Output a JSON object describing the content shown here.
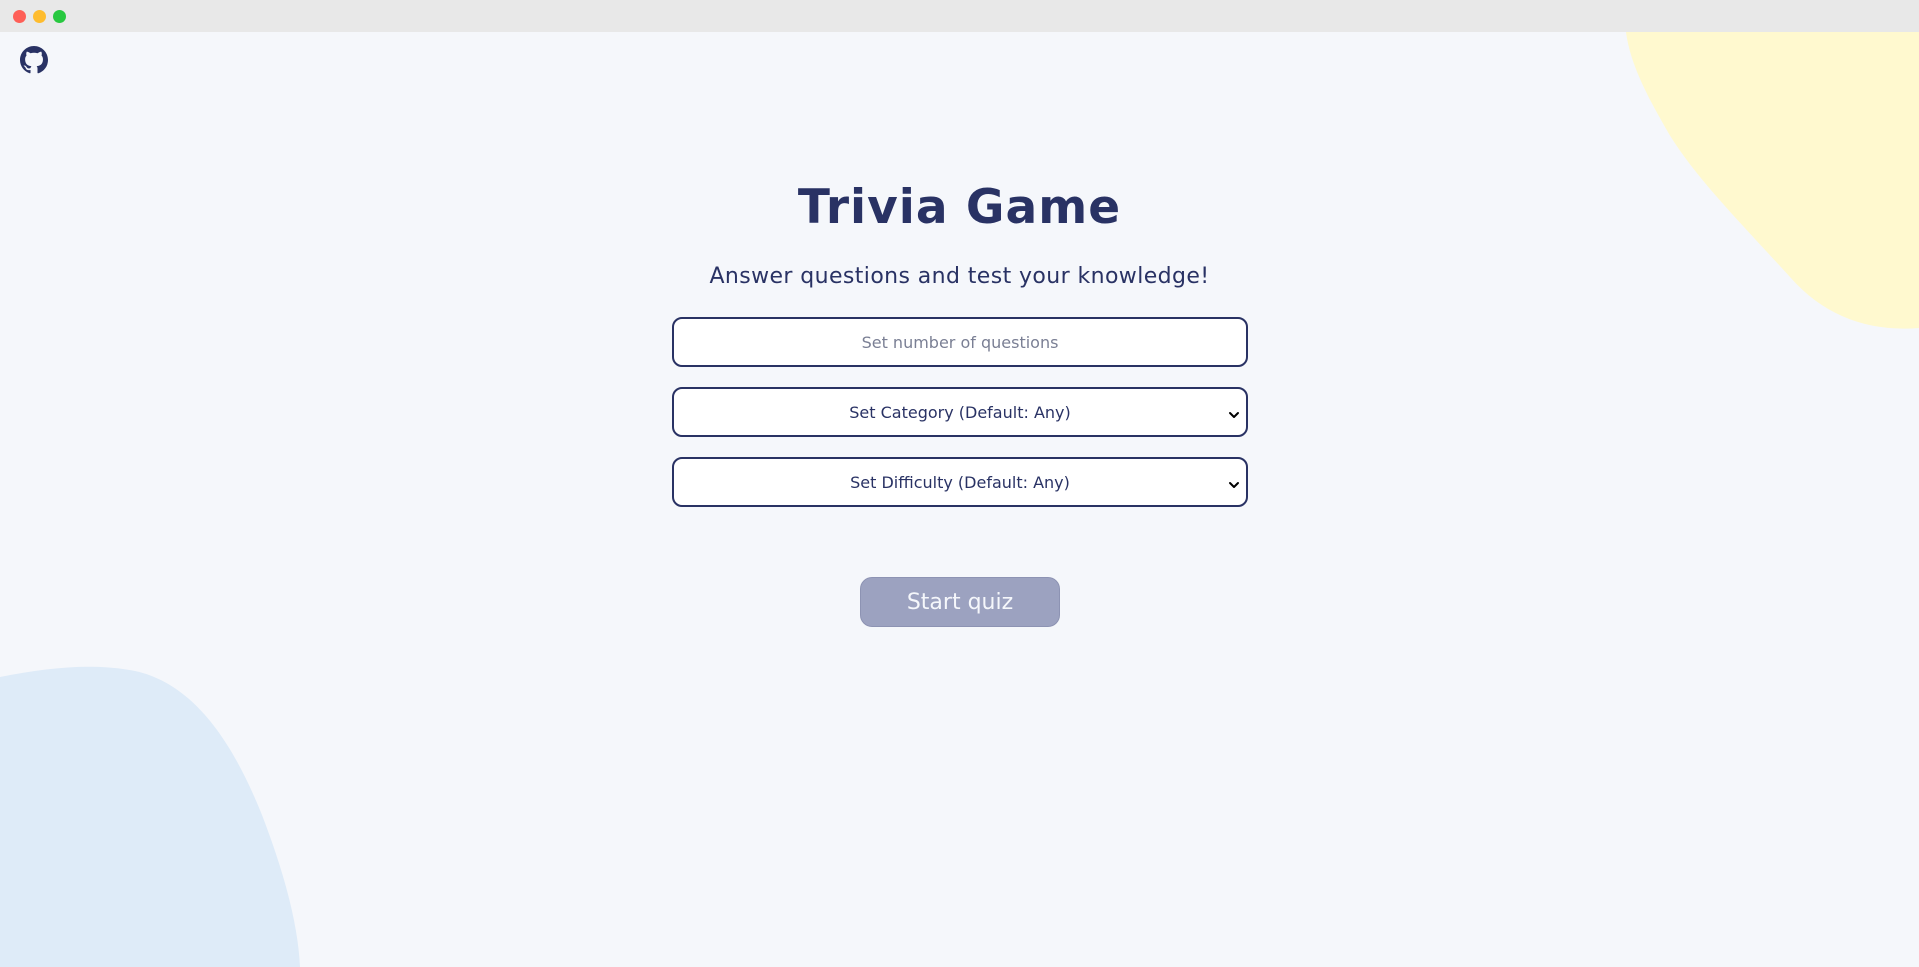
{
  "header": {
    "github_icon": "github-icon"
  },
  "main": {
    "title": "Trivia Game",
    "subtitle": "Answer questions and test your knowledge!",
    "questions_input": {
      "placeholder": "Set number of questions",
      "value": ""
    },
    "category_select": {
      "selected": "Set Category (Default: Any)"
    },
    "difficulty_select": {
      "selected": "Set Difficulty (Default: Any)"
    },
    "start_button_label": "Start quiz"
  },
  "colors": {
    "text": "#293264",
    "background": "#f5f7fb",
    "blob_yellow": "#fff9cf",
    "blob_blue": "#deebf8",
    "button_disabled": "#9ca2c0"
  }
}
